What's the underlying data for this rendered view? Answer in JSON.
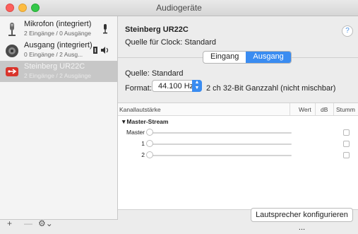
{
  "window": {
    "title": "Audiogeräte"
  },
  "sidebar": {
    "devices": [
      {
        "name": "Mikrofon (integriert)",
        "sub": "2 Eingänge / 0 Ausgänge",
        "icon": "microphone-icon"
      },
      {
        "name": "Ausgang (integriert)",
        "sub": "0 Eingänge / 2 Ausg...",
        "icon": "speaker-icon"
      },
      {
        "name": "Steinberg UR22C",
        "sub": "2 Eingänge / 2 Ausgänge",
        "icon": "usb-icon"
      }
    ],
    "footer": {
      "add": "+",
      "remove": "—",
      "gear": "⚙⌄"
    }
  },
  "detail": {
    "device_title": "Steinberg UR22C",
    "clock_source": "Quelle für Clock:  Standard",
    "help": "?",
    "tabs": [
      "Eingang",
      "Ausgang"
    ],
    "active_tab": "Ausgang",
    "source_label": "Quelle:  Standard",
    "format_label": "Format:",
    "format_rate": "44.100 Hz",
    "format_desc": "2 ch 32-Bit Ganzzahl (nicht mischbar)"
  },
  "table": {
    "columns": [
      "Kanallautstärke",
      "Wert",
      "dB",
      "Stumm"
    ],
    "group": "▼Master-Stream",
    "rows": [
      {
        "label": "Master",
        "level": 0
      },
      {
        "label": "1",
        "level": 0
      },
      {
        "label": "2",
        "level": 0
      }
    ]
  },
  "buttons": {
    "configure_speakers": "Lautsprecher konfigurieren ..."
  }
}
